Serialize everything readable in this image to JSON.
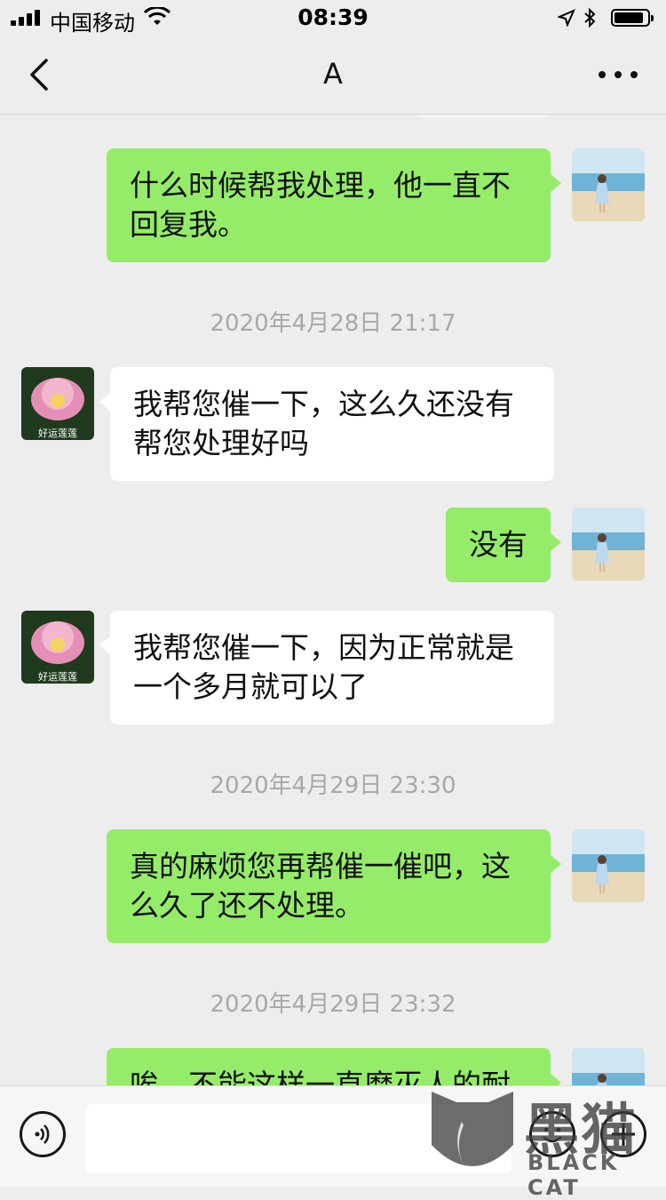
{
  "status_bar": {
    "carrier": "中国移动",
    "time": "08:39",
    "battery_level": 0.9
  },
  "header": {
    "title": "A",
    "back_icon": "chevron-left-icon",
    "more_icon": "more-dots-icon"
  },
  "messages": [
    {
      "side": "out",
      "lines": [
        "什么时候帮我处理，他一直不",
        "回复我。"
      ]
    },
    {
      "type": "timestamp",
      "text": "2020年4月28日 21:17"
    },
    {
      "side": "in",
      "lines": [
        "我帮您催一下，这么久还没有",
        "帮您处理好吗"
      ]
    },
    {
      "side": "out",
      "lines": [
        "没有"
      ]
    },
    {
      "side": "in",
      "lines": [
        "我帮您催一下，因为正常就是",
        "一个多月就可以了"
      ]
    },
    {
      "type": "timestamp",
      "text": "2020年4月29日 23:30"
    },
    {
      "side": "out",
      "lines": [
        "真的麻烦您再帮催一催吧，这",
        "么久了还不处理。"
      ]
    },
    {
      "type": "timestamp",
      "text": "2020年4月29日 23:32"
    },
    {
      "side": "out",
      "lines": [
        "唉，不能这样一直磨灭人的耐"
      ]
    }
  ],
  "avatars": {
    "in_caption": "好运莲莲"
  },
  "input_bar": {
    "voice_icon": "voice-icon",
    "emoji_icon": "emoji-icon",
    "plus_icon": "plus-icon"
  },
  "watermark": {
    "cn": "黑猫",
    "en": "BLACK CAT"
  }
}
